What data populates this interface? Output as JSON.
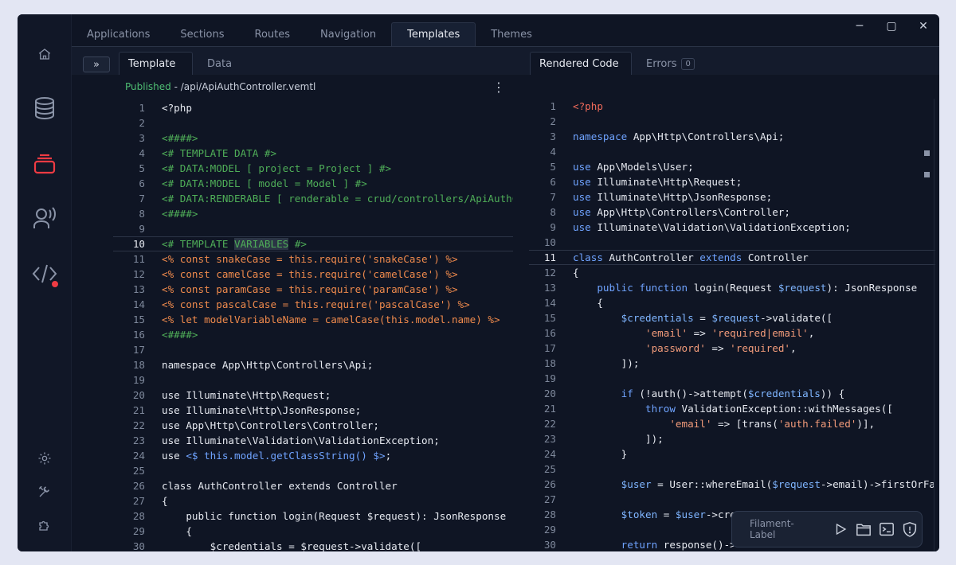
{
  "top_tabs": [
    "Applications",
    "Sections",
    "Routes",
    "Navigation",
    "Templates",
    "Themes"
  ],
  "window_controls": {
    "minimize": "─",
    "maximize": "▢",
    "close": "✕"
  },
  "sub_bar": {
    "toggle": "»",
    "left_tabs": [
      "Template",
      "Data"
    ],
    "right_tabs": [
      "Rendered Code",
      "Errors"
    ],
    "errors_count": "0"
  },
  "file": {
    "status": "Published",
    "separator": " - ",
    "path": "/api/ApiAuthController.vemtl"
  },
  "rail_icons": [
    "home-icon",
    "database-icon",
    "stack-icon",
    "voice-user-icon",
    "code-icon",
    "settings-icon",
    "tools-icon",
    "puzzle-icon"
  ],
  "template_code": [
    {
      "n": "1",
      "t": "<?php"
    },
    {
      "n": "2",
      "t": ""
    },
    {
      "n": "3",
      "t": "<####>"
    },
    {
      "n": "4",
      "t": "<# TEMPLATE DATA #>"
    },
    {
      "n": "5",
      "t": "<# DATA:MODEL [ project = Project ] #>"
    },
    {
      "n": "6",
      "t": "<# DATA:MODEL [ model = Model ] #>"
    },
    {
      "n": "7",
      "t": "<# DATA:RENDERABLE [ renderable = crud/controllers/ApiAuthCo"
    },
    {
      "n": "8",
      "t": "<####>"
    },
    {
      "n": "9",
      "t": ""
    },
    {
      "n": "10",
      "t": "<# TEMPLATE VARIABLES #>"
    },
    {
      "n": "11",
      "t": "<% const snakeCase = this.require('snakeCase') %>"
    },
    {
      "n": "12",
      "t": "<% const camelCase = this.require('camelCase') %>"
    },
    {
      "n": "13",
      "t": "<% const paramCase = this.require('paramCase') %>"
    },
    {
      "n": "14",
      "t": "<% const pascalCase = this.require('pascalCase') %>"
    },
    {
      "n": "15",
      "t": "<% let modelVariableName = camelCase(this.model.name) %>"
    },
    {
      "n": "16",
      "t": "<####>"
    },
    {
      "n": "17",
      "t": ""
    },
    {
      "n": "18",
      "t": "namespace App\\Http\\Controllers\\Api;"
    },
    {
      "n": "19",
      "t": ""
    },
    {
      "n": "20",
      "t": "use Illuminate\\Http\\Request;"
    },
    {
      "n": "21",
      "t": "use Illuminate\\Http\\JsonResponse;"
    },
    {
      "n": "22",
      "t": "use App\\Http\\Controllers\\Controller;"
    },
    {
      "n": "23",
      "t": "use Illuminate\\Validation\\ValidationException;"
    },
    {
      "n": "24",
      "t": "use <$ this.model.getClassString() $>;"
    },
    {
      "n": "25",
      "t": ""
    },
    {
      "n": "26",
      "t": "class AuthController extends Controller"
    },
    {
      "n": "27",
      "t": "{"
    },
    {
      "n": "28",
      "t": "    public function login(Request $request): JsonResponse"
    },
    {
      "n": "29",
      "t": "    {"
    },
    {
      "n": "30",
      "t": "        $credentials = $request->validate(["
    }
  ],
  "rendered_code": [
    {
      "n": "1",
      "t": "<?php"
    },
    {
      "n": "2",
      "t": ""
    },
    {
      "n": "3",
      "t": "namespace App\\Http\\Controllers\\Api;"
    },
    {
      "n": "4",
      "t": ""
    },
    {
      "n": "5",
      "t": "use App\\Models\\User;"
    },
    {
      "n": "6",
      "t": "use Illuminate\\Http\\Request;"
    },
    {
      "n": "7",
      "t": "use Illuminate\\Http\\JsonResponse;"
    },
    {
      "n": "8",
      "t": "use App\\Http\\Controllers\\Controller;"
    },
    {
      "n": "9",
      "t": "use Illuminate\\Validation\\ValidationException;"
    },
    {
      "n": "10",
      "t": ""
    },
    {
      "n": "11",
      "t": "class AuthController extends Controller"
    },
    {
      "n": "12",
      "t": "{"
    },
    {
      "n": "13",
      "t": "    public function login(Request $request): JsonResponse"
    },
    {
      "n": "14",
      "t": "    {"
    },
    {
      "n": "15",
      "t": "        $credentials = $request->validate(["
    },
    {
      "n": "16",
      "t": "            'email' => 'required|email',"
    },
    {
      "n": "17",
      "t": "            'password' => 'required',"
    },
    {
      "n": "18",
      "t": "        ]);"
    },
    {
      "n": "19",
      "t": ""
    },
    {
      "n": "20",
      "t": "        if (!auth()->attempt($credentials)) {"
    },
    {
      "n": "21",
      "t": "            throw ValidationException::withMessages(["
    },
    {
      "n": "22",
      "t": "                'email' => [trans('auth.failed')],"
    },
    {
      "n": "23",
      "t": "            ]);"
    },
    {
      "n": "24",
      "t": "        }"
    },
    {
      "n": "25",
      "t": ""
    },
    {
      "n": "26",
      "t": "        $user = User::whereEmail($request->email)->firstOrFa"
    },
    {
      "n": "27",
      "t": ""
    },
    {
      "n": "28",
      "t": "        $token = $user->cre"
    },
    {
      "n": "29",
      "t": ""
    },
    {
      "n": "30",
      "t": "        return response()->"
    }
  ],
  "toolbar": {
    "label": "Filament-Label",
    "icons": [
      "play-icon",
      "folder-icon",
      "terminal-icon",
      "shield-icon"
    ]
  },
  "colors": {
    "background": "#e3e6f3",
    "window": "#0f1524",
    "template_tag": "#4fae58",
    "template_script": "#ef8a4c",
    "keyword": "#6fa3ff",
    "notification": "#ef3b43"
  }
}
